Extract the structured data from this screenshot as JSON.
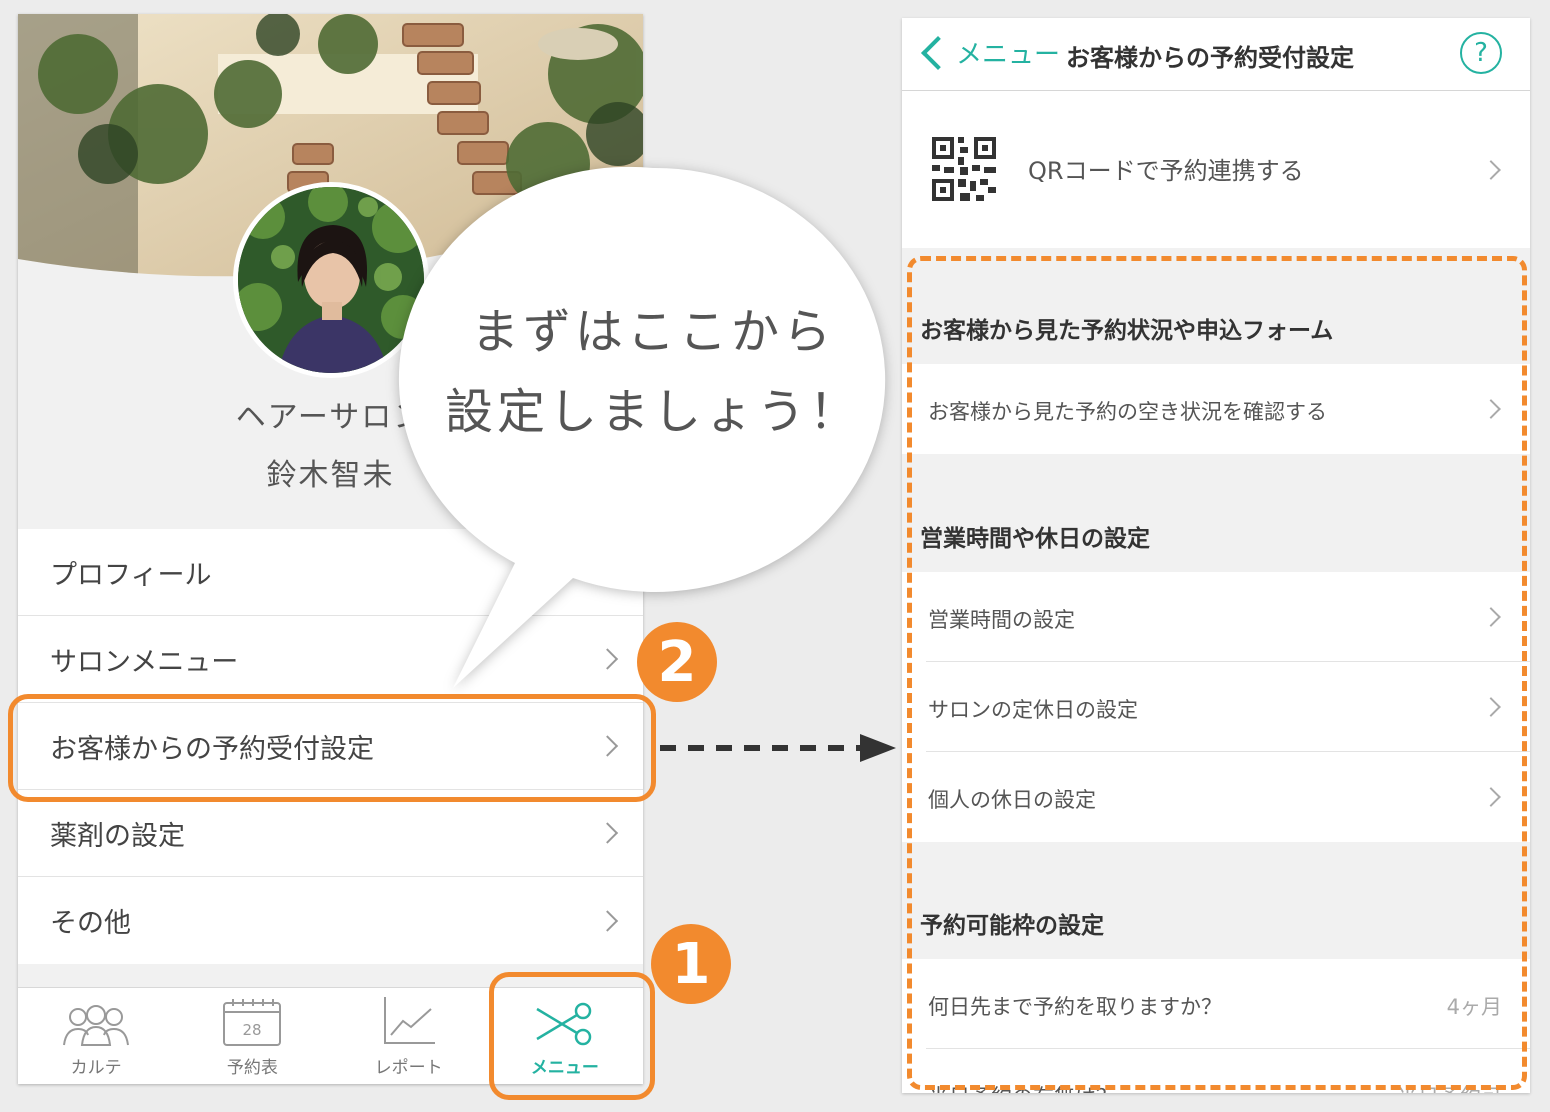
{
  "left_screen": {
    "salon_name": "ヘアーサロン",
    "user_name": "鈴木智未",
    "menu_items": [
      {
        "label": "プロフィール",
        "chevron": false
      },
      {
        "label": "サロンメニュー",
        "chevron": true
      },
      {
        "label": "お客様からの予約受付設定",
        "chevron": true
      },
      {
        "label": "薬剤の設定",
        "chevron": true
      },
      {
        "label": "その他",
        "chevron": true
      }
    ],
    "tabs": [
      {
        "label": "カルテ",
        "icon": "people-icon",
        "active": false
      },
      {
        "label": "予約表",
        "icon": "calendar-icon",
        "calendar_day": "28",
        "active": false
      },
      {
        "label": "レポート",
        "icon": "chart-icon",
        "active": false
      },
      {
        "label": "メニュー",
        "icon": "scissors-icon",
        "active": true
      }
    ]
  },
  "callout": {
    "line1": "まずはここから",
    "line2": "設定しましょう！"
  },
  "step_badges": {
    "step1": "1",
    "step2": "2"
  },
  "right_screen": {
    "nav": {
      "back_label": "メニュー",
      "title": "お客様からの予約受付設定",
      "help": "?"
    },
    "qr_row": {
      "label": "QRコードで予約連携する",
      "icon": "qr-code-icon"
    },
    "sections": [
      {
        "header": "お客様から見た予約状況や申込フォーム",
        "rows": [
          {
            "label": "お客様から見た予約の空き状況を確認する",
            "value": ""
          }
        ]
      },
      {
        "header": "営業時間や休日の設定",
        "rows": [
          {
            "label": "営業時間の設定",
            "value": ""
          },
          {
            "label": "サロンの定休日の設定",
            "value": ""
          },
          {
            "label": "個人の休日の設定",
            "value": ""
          }
        ]
      },
      {
        "header": "予約可能枠の設定",
        "rows": [
          {
            "label": "何日先まで予約を取りますか？",
            "value": "4ヶ月"
          },
          {
            "label": "当日予約の有無は？",
            "value": "当日予約可"
          }
        ]
      }
    ]
  },
  "colors": {
    "accent_teal": "#24b2a1",
    "annotation_orange": "#f28a2e"
  }
}
